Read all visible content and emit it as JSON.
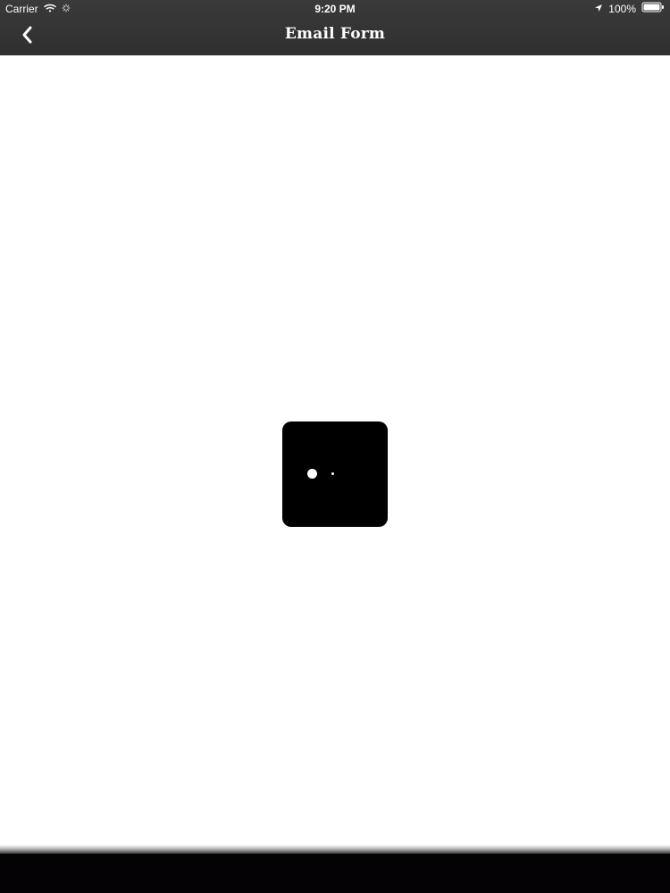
{
  "status_bar": {
    "carrier": "Carrier",
    "time": "9:20 PM",
    "battery_percent": "100%"
  },
  "nav": {
    "title": "Email Form",
    "back_icon": "chevron-left-icon"
  },
  "loading": {
    "indicator_icon": "loading-dots-icon"
  },
  "colors": {
    "chrome_background": "#333333",
    "hud_background": "#000000",
    "page_background": "#ffffff",
    "bottom_bar": "#050205"
  }
}
